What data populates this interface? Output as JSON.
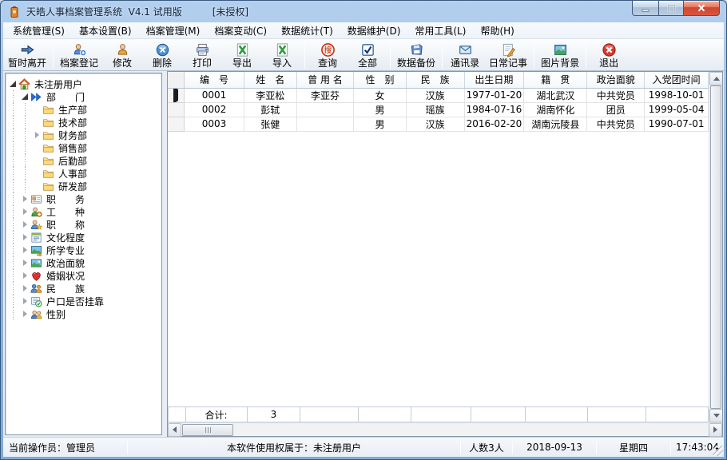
{
  "window": {
    "title": "天皓人事档案管理系统  V4.1 试用版",
    "license_tag": "[未授权]",
    "controls": [
      "minimize-icon",
      "maximize-icon",
      "close-icon"
    ]
  },
  "menu": {
    "items": [
      "系统管理(S)",
      "基本设置(B)",
      "档案管理(M)",
      "档案变动(C)",
      "数据统计(T)",
      "数据维护(D)",
      "常用工具(L)",
      "帮助(H)"
    ]
  },
  "toolbar": {
    "buttons": [
      {
        "label": "暂时离开",
        "icon": "leave-icon",
        "sep_after": true
      },
      {
        "label": "档案登记",
        "icon": "register-icon",
        "sep_after": false
      },
      {
        "label": "修改",
        "icon": "edit-icon",
        "sep_after": false
      },
      {
        "label": "删除",
        "icon": "delete-icon",
        "sep_after": false
      },
      {
        "label": "打印",
        "icon": "print-icon",
        "sep_after": false
      },
      {
        "label": "导出",
        "icon": "export-icon",
        "sep_after": false
      },
      {
        "label": "导入",
        "icon": "import-icon",
        "sep_after": true
      },
      {
        "label": "查询",
        "icon": "search-icon",
        "sep_after": false
      },
      {
        "label": "全部",
        "icon": "select-all-icon",
        "sep_after": true
      },
      {
        "label": "数据备份",
        "icon": "backup-icon",
        "sep_after": true
      },
      {
        "label": "通讯录",
        "icon": "contacts-icon",
        "sep_after": false
      },
      {
        "label": "日常记事",
        "icon": "notes-icon",
        "sep_after": true
      },
      {
        "label": "图片背景",
        "icon": "background-icon",
        "sep_after": true
      },
      {
        "label": "退出",
        "icon": "exit-icon",
        "sep_after": false
      }
    ]
  },
  "tree": {
    "items": [
      {
        "label": "未注册用户",
        "icon": "home-icon",
        "level": 0,
        "expander": "expanded"
      },
      {
        "label": "部　　门",
        "icon": "double-arrow-icon",
        "level": 1,
        "expander": "expanded"
      },
      {
        "label": "生产部",
        "icon": "folder-icon",
        "level": 2,
        "expander": "none"
      },
      {
        "label": "技术部",
        "icon": "folder-icon",
        "level": 2,
        "expander": "none"
      },
      {
        "label": "财务部",
        "icon": "folder-icon",
        "level": 2,
        "expander": "collapsed"
      },
      {
        "label": "销售部",
        "icon": "folder-icon",
        "level": 2,
        "expander": "none"
      },
      {
        "label": "后勤部",
        "icon": "folder-icon",
        "level": 2,
        "expander": "none"
      },
      {
        "label": "人事部",
        "icon": "folder-icon",
        "level": 2,
        "expander": "none"
      },
      {
        "label": "研发部",
        "icon": "folder-icon",
        "level": 2,
        "expander": "none"
      },
      {
        "label": "职　　务",
        "icon": "card-icon",
        "level": 1,
        "expander": "collapsed"
      },
      {
        "label": "工　　种",
        "icon": "worker-icon",
        "level": 1,
        "expander": "collapsed"
      },
      {
        "label": "职　　称",
        "icon": "title-star-icon",
        "level": 1,
        "expander": "collapsed"
      },
      {
        "label": "文化程度",
        "icon": "education-icon",
        "level": 1,
        "expander": "collapsed"
      },
      {
        "label": "所学专业",
        "icon": "major-icon",
        "level": 1,
        "expander": "collapsed"
      },
      {
        "label": "政治面貌",
        "icon": "politics-icon",
        "level": 1,
        "expander": "collapsed"
      },
      {
        "label": "婚姻状况",
        "icon": "marriage-icon",
        "level": 1,
        "expander": "collapsed"
      },
      {
        "label": "民　　族",
        "icon": "nation-icon",
        "level": 1,
        "expander": "collapsed"
      },
      {
        "label": "户口是否挂靠",
        "icon": "residence-icon",
        "level": 1,
        "expander": "collapsed"
      },
      {
        "label": "性别",
        "icon": "gender-icon",
        "level": 1,
        "expander": "collapsed"
      }
    ]
  },
  "table": {
    "headers": [
      "编　号",
      "姓　名",
      "曾 用 名",
      "性　别",
      "民　族",
      "出生日期",
      "籍　贯",
      "政治面貌",
      "入党团时间"
    ],
    "rows": [
      [
        "0001",
        "李亚松",
        "李亚芬",
        "女",
        "汉族",
        "1977-01-20",
        "湖北武汉",
        "中共党员",
        "1998-10-01"
      ],
      [
        "0002",
        "彭轼",
        "",
        "男",
        "瑶族",
        "1984-07-16",
        "湖南怀化",
        "团员",
        "1999-05-04"
      ],
      [
        "0003",
        "张健",
        "",
        "男",
        "汉族",
        "2016-02-20",
        "湖南沅陵县",
        "中共党员",
        "1990-07-01"
      ]
    ],
    "selected_row_index": 0,
    "footer": {
      "label": "合计:",
      "total": "3"
    }
  },
  "statusbar": {
    "operator": "当前操作员：管理员",
    "license": "本软件使用权属于：未注册用户",
    "count": "人数3人",
    "date": "2018-09-13",
    "weekday": "星期四",
    "time": "17:43:04"
  }
}
